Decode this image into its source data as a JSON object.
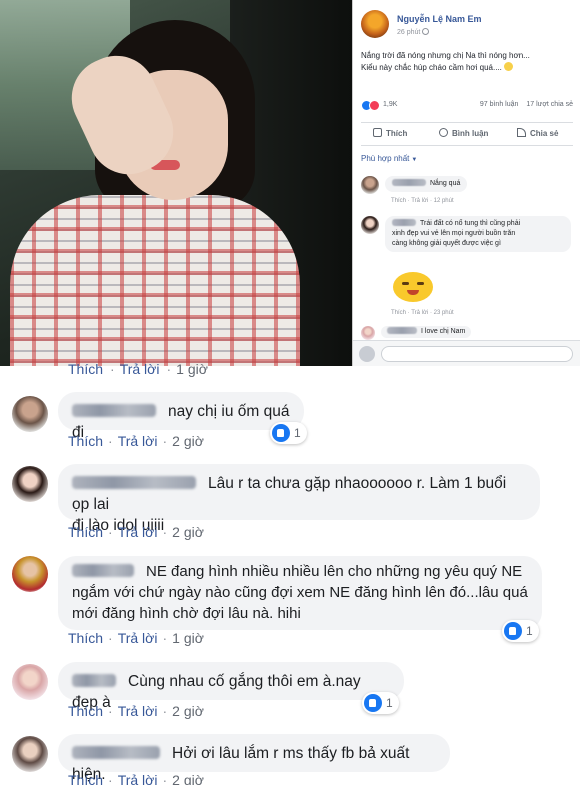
{
  "post": {
    "author": "Nguyễn Lệ Nam Em",
    "time": "26 phút",
    "text_line1": "Nắng trời đã nóng nhưng chị Na thì nóng hơn...",
    "text_line2": "Kiểu này chắc húp cháo cầm hơi quá....",
    "reaction_count": "1,9K",
    "comment_count": "97 bình luận",
    "share_count": "17 lượt chia sẻ",
    "actions": {
      "like": "Thích",
      "comment": "Bình luận",
      "share": "Chia sẻ"
    },
    "sort_label": "Phù hợp nhất",
    "comments": [
      {
        "text": "Nắng quá",
        "time": "12 phút"
      },
      {
        "text_line1": "Trái đất có nổ tung thì cũng phải",
        "text_line2": "xinh đẹp vui vẻ lên mọi người buồn trăn",
        "text_line3": "càng không giải quyết được việc gì",
        "time": ""
      },
      {
        "time": "23 phút"
      },
      {
        "text": "I love chị Nam"
      }
    ]
  },
  "meta": {
    "like": "Thích",
    "reply": "Trả lời",
    "sep": "·"
  },
  "peek": {
    "time": "1 giờ"
  },
  "comments": [
    {
      "text": "nay chị iu ốm quá đi",
      "time": "2 giờ",
      "likes": "1"
    },
    {
      "line1": "Lâu r ta chưa gặp nhaoooooo r. Làm 1 buổi ọp lai",
      "line2": "đi lào idol uiiii",
      "time": "2 giờ"
    },
    {
      "line1": "NE đang hình nhiều nhiều lên cho những ng yêu quý NE",
      "line2": "ngắm với chứ ngày nào cũng đợi xem NE đăng hình lên đó...lâu quá",
      "line3": "mới đăng hình chờ đợi lâu nà. hihi",
      "time": "1 giờ",
      "likes": "1"
    },
    {
      "text": "Cùng nhau cố gắng thôi em à.nay đẹp à",
      "time": "2 giờ",
      "likes": "1"
    },
    {
      "text": "Hởi ơi lâu lắm r ms thấy fb bả xuất hiện.",
      "time": "2 giờ"
    }
  ]
}
